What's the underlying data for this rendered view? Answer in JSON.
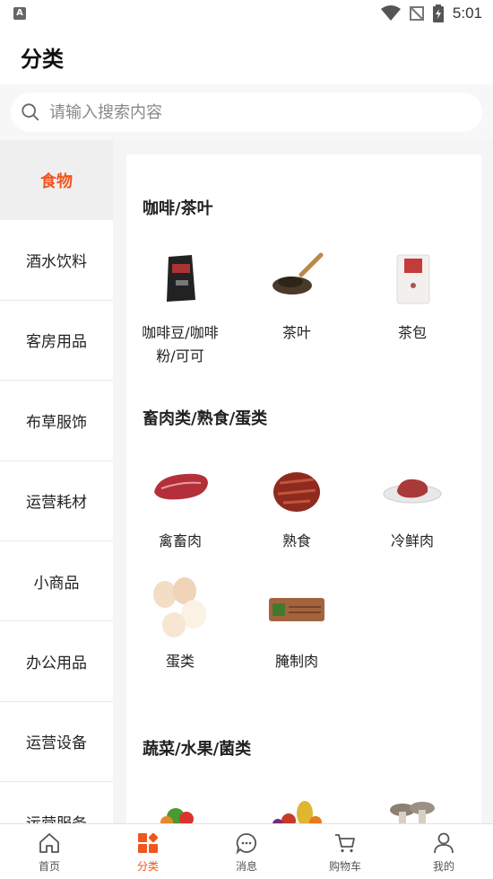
{
  "status_bar": {
    "time": "5:01",
    "app_badge": "A"
  },
  "header": {
    "title": "分类"
  },
  "search": {
    "placeholder": "请输入搜索内容"
  },
  "sidebar": {
    "items": [
      {
        "label": "食物",
        "active": true
      },
      {
        "label": "酒水饮料"
      },
      {
        "label": "客房用品"
      },
      {
        "label": "布草服饰"
      },
      {
        "label": "运营耗材"
      },
      {
        "label": "小商品"
      },
      {
        "label": "办公用品"
      },
      {
        "label": "运营设备"
      },
      {
        "label": "运营服务"
      }
    ]
  },
  "sections": [
    {
      "title": "咖啡/茶叶",
      "items": [
        "咖啡豆/咖啡粉/可可",
        "茶叶",
        "茶包"
      ]
    },
    {
      "title": "畜肉类/熟食/蛋类",
      "items": [
        "禽畜肉",
        "熟食",
        "冷鲜肉",
        "蛋类",
        "腌制肉"
      ]
    },
    {
      "title": "蔬菜/水果/菌类",
      "items": []
    }
  ],
  "coffee_label_lines": [
    "咖啡豆/咖啡",
    "粉/可可"
  ],
  "tabbar": {
    "tabs": [
      {
        "label": "首页",
        "icon": "home-icon"
      },
      {
        "label": "分类",
        "icon": "category-icon",
        "active": true
      },
      {
        "label": "消息",
        "icon": "message-icon"
      },
      {
        "label": "购物车",
        "icon": "cart-icon"
      },
      {
        "label": "我的",
        "icon": "profile-icon"
      }
    ]
  },
  "colors": {
    "accent": "#f0561e",
    "text": "#222222",
    "inactive_tab": "#555555"
  }
}
